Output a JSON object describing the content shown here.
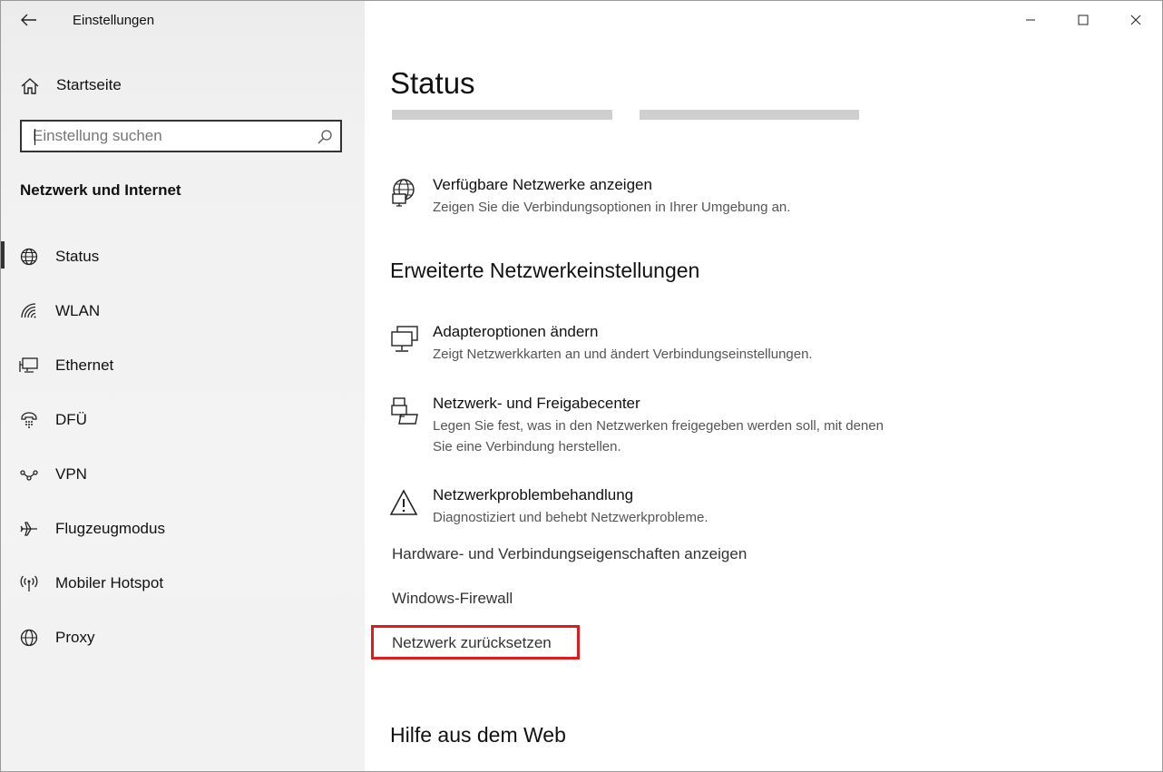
{
  "window": {
    "title": "Einstellungen"
  },
  "sidebar": {
    "home_label": "Startseite",
    "search_placeholder": "Einstellung suchen",
    "section_title": "Netzwerk und Internet",
    "items": [
      {
        "label": "Status",
        "icon": "globe-icon",
        "selected": true
      },
      {
        "label": "WLAN",
        "icon": "wifi-icon"
      },
      {
        "label": "Ethernet",
        "icon": "ethernet-icon"
      },
      {
        "label": "DFÜ",
        "icon": "dialup-icon"
      },
      {
        "label": "VPN",
        "icon": "vpn-icon"
      },
      {
        "label": "Flugzeugmodus",
        "icon": "airplane-icon"
      },
      {
        "label": "Mobiler Hotspot",
        "icon": "hotspot-icon"
      },
      {
        "label": "Proxy",
        "icon": "proxy-globe-icon"
      }
    ]
  },
  "main": {
    "page_title": "Status",
    "available_networks": {
      "title": "Verfügbare Netzwerke anzeigen",
      "desc": "Zeigen Sie die Verbindungsoptionen in Ihrer Umgebung an.",
      "icon": "globe-monitor-icon"
    },
    "advanced_heading": "Erweiterte Netzwerkeinstellungen",
    "advanced_items": [
      {
        "title": "Adapteroptionen ändern",
        "desc": "Zeigt Netzwerkkarten an und ändert Verbindungseinstellungen.",
        "icon": "adapter-icon"
      },
      {
        "title": "Netzwerk- und Freigabecenter",
        "desc": "Legen Sie fest, was in den Netzwerken freigegeben werden soll, mit denen Sie eine Verbindung herstellen.",
        "icon": "sharing-center-icon"
      },
      {
        "title": "Netzwerkproblembehandlung",
        "desc": "Diagnostiziert und behebt Netzwerkprobleme.",
        "icon": "warning-icon"
      }
    ],
    "links": [
      "Hardware- und Verbindungseigenschaften anzeigen",
      "Windows-Firewall",
      "Netzwerk zurücksetzen"
    ],
    "help_heading": "Hilfe aus dem Web"
  },
  "colors": {
    "highlight": "#e11b1b",
    "sidebar_bg": "#f2f2f2"
  }
}
